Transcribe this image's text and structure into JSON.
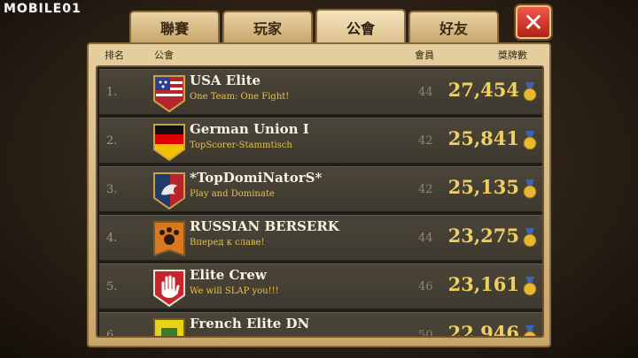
{
  "watermark": "MOBILE01",
  "tabs": [
    {
      "label": "聯賽",
      "active": false
    },
    {
      "label": "玩家",
      "active": false
    },
    {
      "label": "公會",
      "active": true
    },
    {
      "label": "好友",
      "active": false
    }
  ],
  "close_label": "✕",
  "columns": {
    "rank": "排名",
    "guild": "公會",
    "members": "會員",
    "medals": "獎牌數"
  },
  "guilds": [
    {
      "rank": "1.",
      "name": "USA Elite",
      "motto": "One Team: One Fight!",
      "members": "44",
      "medals": "27,454",
      "emblem": "usa-flag-icon"
    },
    {
      "rank": "2.",
      "name": "German Union I",
      "motto": "TopScorer-Stammtisch",
      "members": "42",
      "medals": "25,841",
      "emblem": "germany-flag-icon"
    },
    {
      "rank": "3.",
      "name": "*TopDomiNatorS*",
      "motto": "Play and Dominate",
      "members": "42",
      "medals": "25,135",
      "emblem": "dragon-icon"
    },
    {
      "rank": "4.",
      "name": "RUSSIAN BERSERK",
      "motto": "Вперед к славе!",
      "members": "44",
      "medals": "23,275",
      "emblem": "paw-icon"
    },
    {
      "rank": "5.",
      "name": "Elite Crew",
      "motto": "We will SLAP you!!!",
      "members": "46",
      "medals": "23,161",
      "emblem": "hand-icon"
    },
    {
      "rank": "6.",
      "name": "French Elite DN",
      "motto": "",
      "members": "50",
      "medals": "22,946",
      "emblem": "yellow-banner-icon"
    }
  ],
  "colors": {
    "medal_text": "#f0cf62",
    "motto_text": "#e9c24a",
    "close_button": "#d83a2c"
  }
}
